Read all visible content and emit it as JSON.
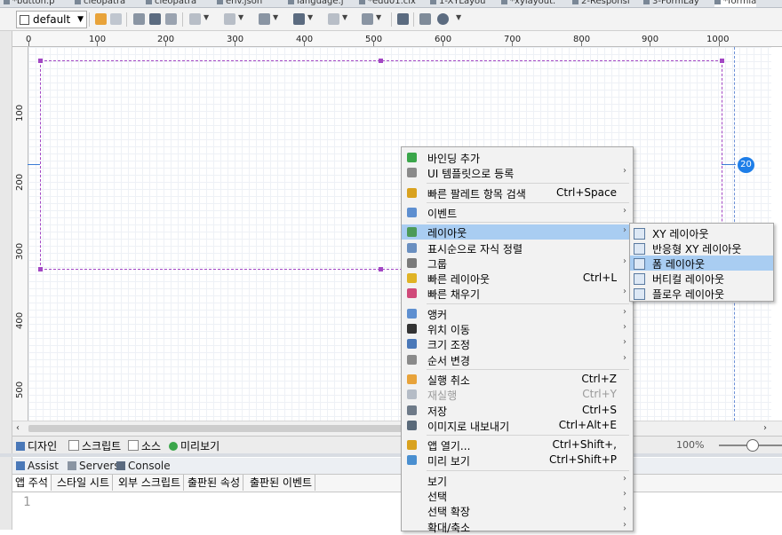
{
  "tabs": [
    "*button.p",
    "cleopatra",
    "cleopatra",
    "env.json",
    "language.j",
    "*edu01.clx",
    "1-XYLayou",
    "*xylayout.",
    "2-Responsi",
    "3-FormLay",
    "*formla"
  ],
  "toolbar": {
    "layout_combo": "default",
    "colors": {
      "undo": "#e8a33a",
      "redo": "#9aa3b0",
      "action": "#5b6b80"
    }
  },
  "ruler": {
    "h_labels": [
      "0",
      "100",
      "200",
      "300",
      "400",
      "500",
      "600",
      "700",
      "800",
      "900",
      "1000"
    ],
    "v_labels": [
      "100",
      "200",
      "300",
      "400",
      "500"
    ]
  },
  "canvas": {
    "dimension_badge": "20"
  },
  "view_tabs": [
    {
      "label": "디자인",
      "icon": "design-icon"
    },
    {
      "label": "스크립트",
      "icon": "script-icon"
    },
    {
      "label": "소스",
      "icon": "source-icon"
    },
    {
      "label": "미리보기",
      "icon": "preview-play-icon"
    }
  ],
  "zoom": "100%",
  "panel_tabs": [
    "Assist",
    "Servers",
    "Console"
  ],
  "sub_tabs": [
    "앱 주석",
    "스타일 시트",
    "외부 스크립트",
    "출판된 속성",
    "출판된 이벤트"
  ],
  "editor": {
    "line_number": "1"
  },
  "context_menu": {
    "items": [
      {
        "label": "바인딩 추가",
        "shortcut": "",
        "submenu": false,
        "icon": "add-binding-icon",
        "color": "#3aa64a"
      },
      {
        "label": "UI 템플릿으로 등록",
        "shortcut": "",
        "submenu": true,
        "icon": "template-icon",
        "color": "#8a8a8a"
      },
      {
        "sep": true
      },
      {
        "label": "빠른 팔레트 항목 검색",
        "shortcut": "Ctrl+Space",
        "submenu": false,
        "icon": "palette-search-icon",
        "color": "#d9a21f"
      },
      {
        "sep": true
      },
      {
        "label": "이벤트",
        "shortcut": "",
        "submenu": true,
        "icon": "event-icon",
        "color": "#5e8fd0"
      },
      {
        "sep": true
      },
      {
        "label": "레이아웃",
        "shortcut": "",
        "submenu": true,
        "icon": "layout-icon",
        "color": "#4c9a57",
        "highlight": true
      },
      {
        "label": "표시순으로 자식 정렬",
        "shortcut": "",
        "submenu": false,
        "icon": "sort-children-icon",
        "color": "#6a8fc0"
      },
      {
        "label": "그룹",
        "shortcut": "",
        "submenu": true,
        "icon": "group-icon",
        "color": "#7a7a7a"
      },
      {
        "label": "빠른 레이아웃",
        "shortcut": "Ctrl+L",
        "submenu": false,
        "icon": "quick-layout-icon",
        "color": "#e0b325"
      },
      {
        "label": "빠른 채우기",
        "shortcut": "",
        "submenu": true,
        "icon": "quick-fill-icon",
        "color": "#d04a7a"
      },
      {
        "sep": true
      },
      {
        "label": "앵커",
        "shortcut": "",
        "submenu": true,
        "icon": "anchor-icon",
        "color": "#5e8fd0"
      },
      {
        "label": "위치 이동",
        "shortcut": "",
        "submenu": true,
        "icon": "move-icon",
        "color": "#333333"
      },
      {
        "label": "크기 조정",
        "shortcut": "",
        "submenu": true,
        "icon": "resize-icon",
        "color": "#4a78b8"
      },
      {
        "label": "순서 변경",
        "shortcut": "",
        "submenu": true,
        "icon": "reorder-icon",
        "color": "#8a8a8a"
      },
      {
        "sep": true
      },
      {
        "label": "실행 취소",
        "shortcut": "Ctrl+Z",
        "submenu": false,
        "icon": "undo-icon",
        "color": "#e8a33a"
      },
      {
        "label": "재실행",
        "shortcut": "Ctrl+Y",
        "submenu": false,
        "icon": "redo-icon",
        "color": "#b5bcc6",
        "disabled": true
      },
      {
        "label": "저장",
        "shortcut": "Ctrl+S",
        "submenu": false,
        "icon": "save-icon",
        "color": "#6e7a88"
      },
      {
        "label": "이미지로 내보내기",
        "shortcut": "Ctrl+Alt+E",
        "submenu": false,
        "icon": "export-image-icon",
        "color": "#5a6a7a"
      },
      {
        "sep": true
      },
      {
        "label": "앱 열기...",
        "shortcut": "Ctrl+Shift+,",
        "submenu": false,
        "icon": "open-app-icon",
        "color": "#d9a21f"
      },
      {
        "label": "미리 보기",
        "shortcut": "Ctrl+Shift+P",
        "submenu": false,
        "icon": "preview-icon",
        "color": "#4a8fd0"
      },
      {
        "sep": true
      },
      {
        "label": "보기",
        "shortcut": "",
        "submenu": true,
        "icon": "",
        "color": ""
      },
      {
        "label": "선택",
        "shortcut": "",
        "submenu": true,
        "icon": "",
        "color": ""
      },
      {
        "label": "선택 확장",
        "shortcut": "",
        "submenu": true,
        "icon": "",
        "color": ""
      },
      {
        "label": "확대/축소",
        "shortcut": "",
        "submenu": true,
        "icon": "",
        "color": ""
      }
    ]
  },
  "layout_submenu": {
    "items": [
      {
        "label": "XY 레이아웃",
        "icon": "xy-layout-icon"
      },
      {
        "label": "반응형 XY 레이아웃",
        "icon": "responsive-xy-layout-icon"
      },
      {
        "label": "폼 레이아웃",
        "icon": "form-layout-icon",
        "highlight": true
      },
      {
        "label": "버티컬 레이아웃",
        "icon": "vertical-layout-icon"
      },
      {
        "label": "플로우 레이아웃",
        "icon": "flow-layout-icon"
      }
    ]
  }
}
